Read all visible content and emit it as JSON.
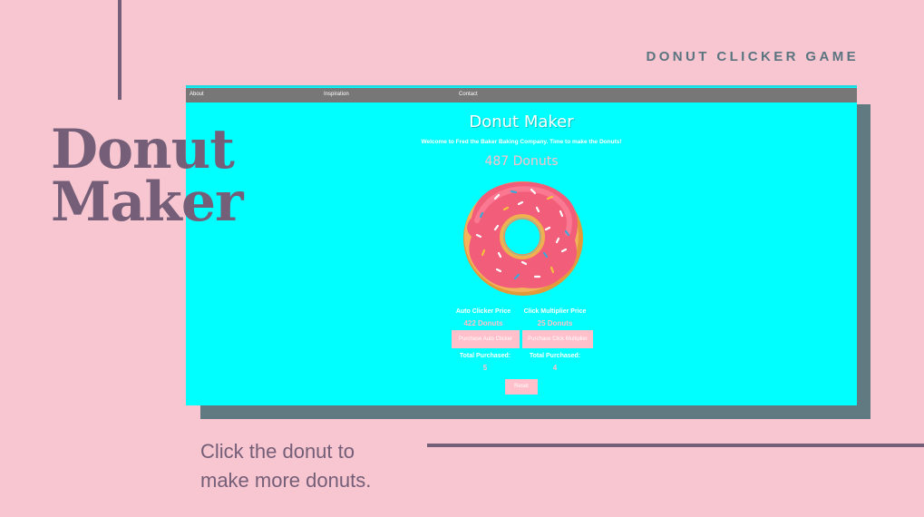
{
  "slide": {
    "label": "DONUT CLICKER GAME",
    "title_line1": "Donut",
    "title_line2": "Maker",
    "caption_line1": "Click the donut to",
    "caption_line2": "make more donuts."
  },
  "app": {
    "nav": [
      "About",
      "Inspiration",
      "Contact"
    ],
    "title": "Donut Maker",
    "welcome": "Welcome to Fred the Baker Baking Company. Time to make the Donuts!",
    "donut_count": "487 Donuts",
    "auto_clicker": {
      "price_label": "Auto Clicker Price",
      "price": "422 Donuts",
      "button": "Purchase Auto Clicker",
      "total_label": "Total Purchased:",
      "total": "5"
    },
    "click_multiplier": {
      "price_label": "Click Multiplier Price",
      "price": "25 Donuts",
      "button": "Purchase Click Multiplier",
      "total_label": "Total Purchased:",
      "total": "4"
    },
    "reset_button": "Reset"
  },
  "colors": {
    "background": "#f7c6d0",
    "accent": "#745e78",
    "screen": "#00ffff",
    "button": "#ffc0cb",
    "shadow": "#617a82"
  },
  "icons": {
    "donut": "donut-icon"
  }
}
